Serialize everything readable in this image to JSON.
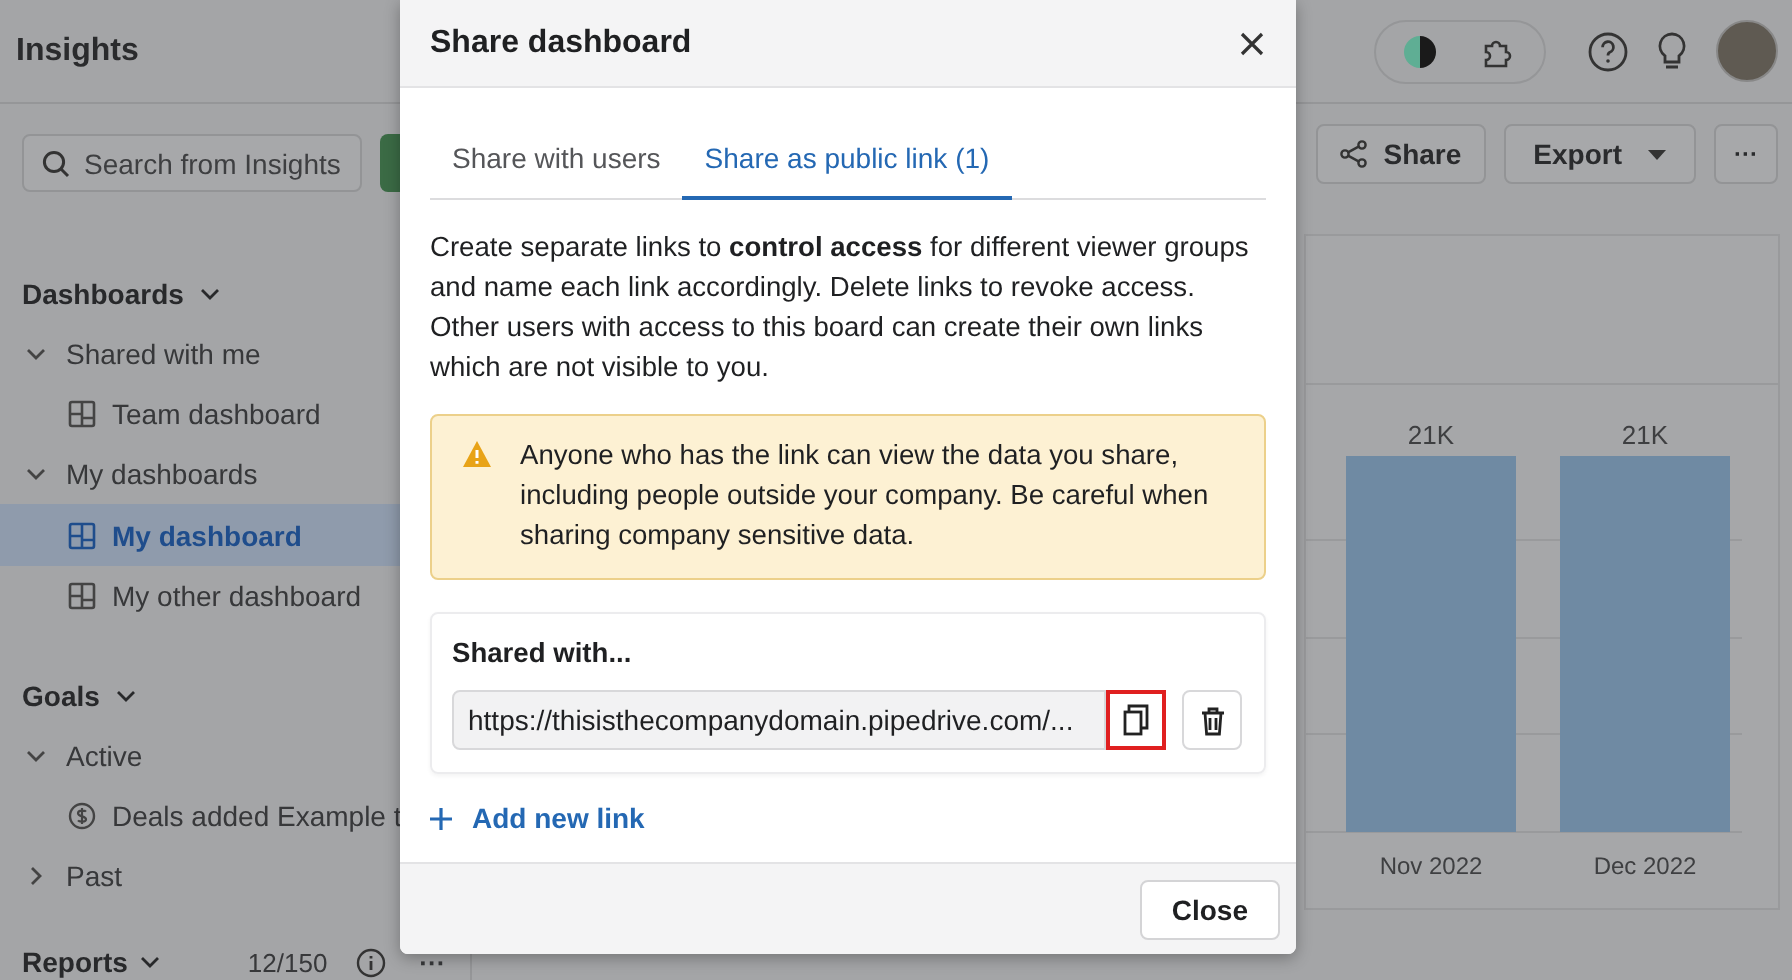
{
  "app": {
    "title": "Insights",
    "search": {
      "placeholder": "Search from Insights"
    },
    "sidebar": {
      "sections": [
        {
          "label": "Dashboards",
          "expanded": true,
          "groups": [
            {
              "label": "Shared with me",
              "expanded": true,
              "children": [
                {
                  "label": "Team dashboard",
                  "kind": "dashboard",
                  "selected": false
                }
              ]
            },
            {
              "label": "My dashboards",
              "expanded": true,
              "children": [
                {
                  "label": "My dashboard",
                  "kind": "dashboard",
                  "selected": true
                },
                {
                  "label": "My other dashboard",
                  "kind": "dashboard",
                  "selected": false
                }
              ]
            }
          ]
        },
        {
          "label": "Goals",
          "expanded": true,
          "groups": [
            {
              "label": "Active",
              "expanded": true,
              "children": [
                {
                  "label": "Deals added Example t",
                  "kind": "goal",
                  "selected": false
                }
              ]
            },
            {
              "label": "Past",
              "expanded": false
            }
          ]
        }
      ],
      "reports": {
        "label": "Reports",
        "count": "12/150",
        "more": "···"
      }
    },
    "toolbar": {
      "share": "Share",
      "export": "Export",
      "more": "···"
    },
    "chart": {
      "bars": [
        {
          "category": "Nov 2022",
          "value_label": "21K"
        },
        {
          "category": "Dec 2022",
          "value_label": "21K"
        }
      ]
    }
  },
  "dialog": {
    "title": "Share dashboard",
    "tabs": [
      {
        "label": "Share with users",
        "selected": false
      },
      {
        "label": "Share as public link (1)",
        "selected": true
      }
    ],
    "description": "Create separate links to **control access** for different viewer groups and name each link accordingly. Delete links to revoke access. Other users with access to this board can create their own links which are not visible to you.",
    "warning": "Anyone who has the link can view the data you share, including people outside your company. Be careful when sharing company sensitive data.",
    "shared_with": {
      "label": "Shared with...",
      "links": [
        {
          "value": "https://thisisthecompanydomain.pipedrive.com/...",
          "copy_highlighted": true
        }
      ]
    },
    "add_link": "Add new link",
    "close_button": "Close"
  }
}
